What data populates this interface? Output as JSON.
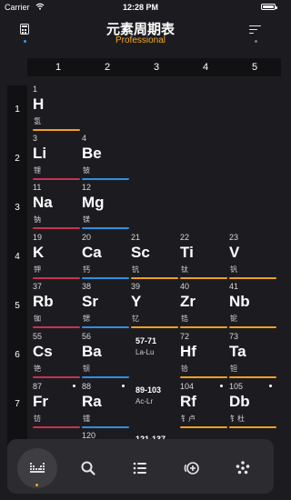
{
  "status_bar": {
    "carrier": "Carrier",
    "time": "12:28 PM"
  },
  "nav": {
    "title": "元素周期表",
    "subtitle": "Professional"
  },
  "columns": [
    "1",
    "2",
    "3",
    "4",
    "5"
  ],
  "rows": [
    "1",
    "2",
    "3",
    "4",
    "5",
    "6",
    "7"
  ],
  "elements": [
    {
      "number": "1",
      "symbol": "H",
      "name": "氢"
    },
    {
      "number": "3",
      "symbol": "Li",
      "name": "锂"
    },
    {
      "number": "4",
      "symbol": "Be",
      "name": "铍"
    },
    {
      "number": "11",
      "symbol": "Na",
      "name": "钠"
    },
    {
      "number": "12",
      "symbol": "Mg",
      "name": "镁"
    },
    {
      "number": "19",
      "symbol": "K",
      "name": "钾"
    },
    {
      "number": "20",
      "symbol": "Ca",
      "name": "钙"
    },
    {
      "number": "21",
      "symbol": "Sc",
      "name": "钪"
    },
    {
      "number": "22",
      "symbol": "Ti",
      "name": "钛"
    },
    {
      "number": "23",
      "symbol": "V",
      "name": "钒"
    },
    {
      "number": "37",
      "symbol": "Rb",
      "name": "铷"
    },
    {
      "number": "38",
      "symbol": "Sr",
      "name": "锶"
    },
    {
      "number": "39",
      "symbol": "Y",
      "name": "钇"
    },
    {
      "number": "40",
      "symbol": "Zr",
      "name": "锆"
    },
    {
      "number": "41",
      "symbol": "Nb",
      "name": "铌"
    },
    {
      "number": "55",
      "symbol": "Cs",
      "name": "铯"
    },
    {
      "number": "56",
      "symbol": "Ba",
      "name": "钡"
    },
    {
      "number": "72",
      "symbol": "Hf",
      "name": "铪"
    },
    {
      "number": "73",
      "symbol": "Ta",
      "name": "钽"
    },
    {
      "number": "87",
      "symbol": "Fr",
      "name": "钫"
    },
    {
      "number": "88",
      "symbol": "Ra",
      "name": "镭"
    },
    {
      "number": "104",
      "symbol": "Rf",
      "name": "钅卢"
    },
    {
      "number": "105",
      "symbol": "Db",
      "name": "钅杜"
    }
  ],
  "groups": [
    {
      "range": "57-71",
      "label": "La-Lu"
    },
    {
      "range": "89-103",
      "label": "Ac-Lr"
    },
    {
      "range": "121-137",
      "label": ""
    }
  ],
  "category_colors": {
    "nonmetal": "#f0a020",
    "alkali": "#c8324e",
    "alkaline": "#2e8fe0",
    "transition": "#f0a020"
  },
  "tabs": [
    {
      "icon": "table-icon",
      "active": true
    },
    {
      "icon": "search-icon"
    },
    {
      "icon": "list-icon"
    },
    {
      "icon": "add-circle-icon"
    },
    {
      "icon": "dots-icon"
    }
  ]
}
